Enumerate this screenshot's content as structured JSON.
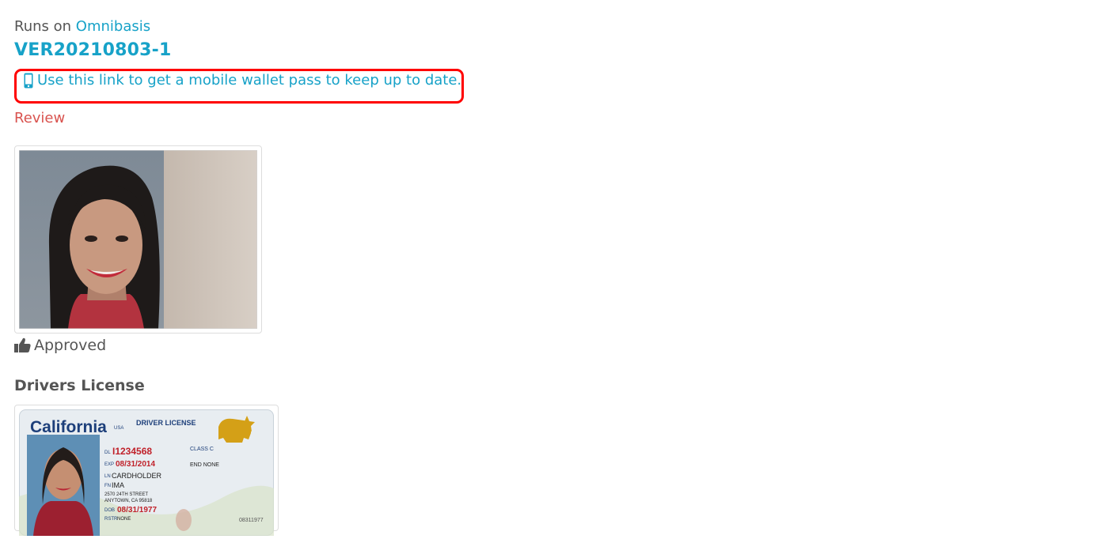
{
  "header": {
    "runs_on_prefix": "Runs on",
    "platform_link": "Omnibasis",
    "verification_id": "VER20210803-1"
  },
  "wallet": {
    "icon": "mobile-phone-icon",
    "link_text": "Use this link to get a mobile wallet pass to keep up to date."
  },
  "review_link": "Review",
  "photo": {
    "status_icon": "thumbs-up-icon",
    "status": "Approved"
  },
  "document": {
    "title": "Drivers License",
    "card": {
      "state": "California",
      "usa": "USA",
      "type": "DRIVER LICENSE",
      "dl_label": "DL",
      "dl_number": "I1234568",
      "exp_label": "EXP",
      "exp_date": "08/31/2014",
      "class_label": "CLASS C",
      "end_label": "END NONE",
      "ln_label": "LN",
      "last_name": "CARDHOLDER",
      "fn_label": "FN",
      "first_name": "IMA",
      "address_line1": "2570 24TH STREET",
      "address_line2": "ANYTOWN, CA 95818",
      "dob_label": "DOB",
      "dob": "08/31/1977",
      "rstr_label": "RSTR",
      "rstr": "NONE",
      "side_number": "08311977"
    }
  },
  "colors": {
    "link": "#17a2c8",
    "review": "#d9534f",
    "highlight": "#ff0000",
    "text": "#555555"
  }
}
